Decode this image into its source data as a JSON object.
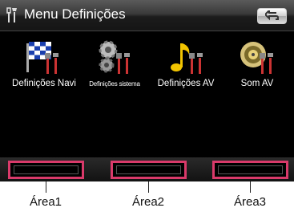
{
  "header": {
    "title": "Menu Definições",
    "title_icon": "settings-tools-icon",
    "back_icon": "back-arrow-icon"
  },
  "menu": {
    "items": [
      {
        "label": "Definições Navi",
        "icon": "checkered-flag-tools-icon"
      },
      {
        "label": "Definições sistema",
        "icon": "gears-tools-icon"
      },
      {
        "label": "Definições AV",
        "icon": "music-note-tools-icon"
      },
      {
        "label": "Som AV",
        "icon": "speaker-tools-icon"
      }
    ]
  },
  "callouts": [
    "Área1",
    "Área2",
    "Área3"
  ],
  "colors": {
    "highlight": "#d93a6a",
    "background": "#000000",
    "label": "#ffffff"
  }
}
